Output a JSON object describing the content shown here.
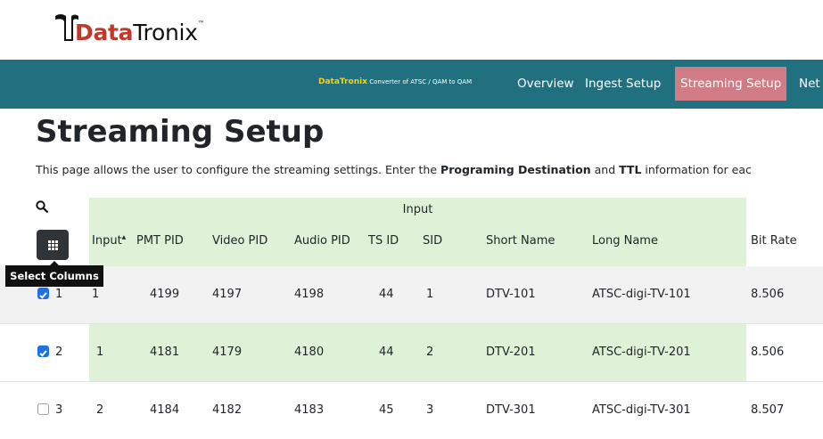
{
  "logo": {
    "part1": "Data",
    "part2": "Tronix",
    "tm": "™"
  },
  "nav": {
    "brand_name": "DataTronix",
    "brand_tagline": "Converter of ATSC / QAM to QAM",
    "links": [
      "Overview",
      "Ingest Setup",
      "Streaming Setup",
      "Net"
    ],
    "active": "Streaming Setup"
  },
  "page": {
    "title": "Streaming Setup",
    "desc_1": "This page allows the user to configure the streaming settings. Enter the ",
    "desc_bold_1": "Programing Destination",
    "desc_2": " and ",
    "desc_bold_2": "TTL",
    "desc_3": " information for eac"
  },
  "table": {
    "group_header": "Input",
    "select_columns_tooltip": "Select Columns",
    "headers": [
      "Input",
      "PMT PID",
      "Video PID",
      "Audio PID",
      "TS ID",
      "SID",
      "Short Name",
      "Long Name",
      "Bit Rate"
    ],
    "sort_indicator": "▲",
    "rows": [
      {
        "num": "1",
        "checked": true,
        "input": "1",
        "pmt": "4199",
        "video": "4197",
        "audio": "4198",
        "tsid": "44",
        "sid": "1",
        "short": "DTV-101",
        "long": "ATSC-digi-TV-101",
        "bitrate": "8.506"
      },
      {
        "num": "2",
        "checked": true,
        "input": "1",
        "pmt": "4181",
        "video": "4179",
        "audio": "4180",
        "tsid": "44",
        "sid": "2",
        "short": "DTV-201",
        "long": "ATSC-digi-TV-201",
        "bitrate": "8.506"
      },
      {
        "num": "3",
        "checked": false,
        "input": "2",
        "pmt": "4184",
        "video": "4182",
        "audio": "4183",
        "tsid": "45",
        "sid": "3",
        "short": "DTV-301",
        "long": "ATSC-digi-TV-301",
        "bitrate": "8.507"
      }
    ]
  },
  "colors": {
    "nav_bg": "#20707f",
    "active_tab": "#d17b86",
    "input_group": "#dff2d8",
    "checkbox": "#1f6fe5"
  }
}
